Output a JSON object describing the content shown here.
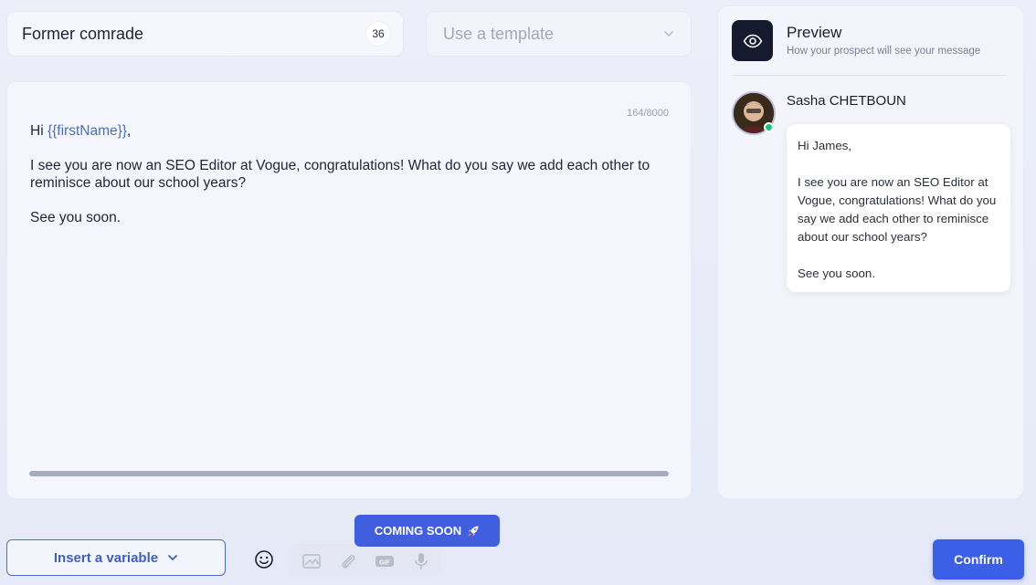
{
  "title_input": {
    "value": "Former comrade",
    "count": "36"
  },
  "template_select": {
    "placeholder": "Use a template"
  },
  "editor": {
    "char_count": "164/8000",
    "greeting_prefix": "Hi ",
    "greeting_variable": "{{firstName}}",
    "greeting_suffix": ",",
    "paragraph_1": "I see you are now an SEO Editor at Vogue, congratulations! What do you say we add each other to reminisce about our school years?",
    "paragraph_2": "See you soon."
  },
  "preview": {
    "title": "Preview",
    "subtitle": "How your prospect will see your message",
    "sender_name": "Sasha CHETBOUN",
    "message": {
      "greeting": "Hi James,",
      "paragraph_1": "I see you are now an SEO Editor at Vogue, congratulations! What do you say we add each other to reminisce about our school years?",
      "paragraph_2": "See you soon."
    }
  },
  "toolbar": {
    "insert_variable_label": "Insert a variable",
    "coming_soon_label": "COMING SOON",
    "confirm_label": "Confirm"
  },
  "icons": {
    "template_chevron": "chevron-down-icon",
    "insert_chevron": "chevron-down-icon",
    "eye": "eye-icon",
    "emoji": "smiley-icon",
    "image": "image-icon",
    "attachment": "paperclip-icon",
    "gif": "gif-icon",
    "microphone": "microphone-icon",
    "rocket": "rocket-icon"
  },
  "colors": {
    "accent": "#3b5fe6",
    "variable": "#4b6cc7",
    "online": "#1cc47a",
    "preview_icon_bg": "#161a2e"
  }
}
